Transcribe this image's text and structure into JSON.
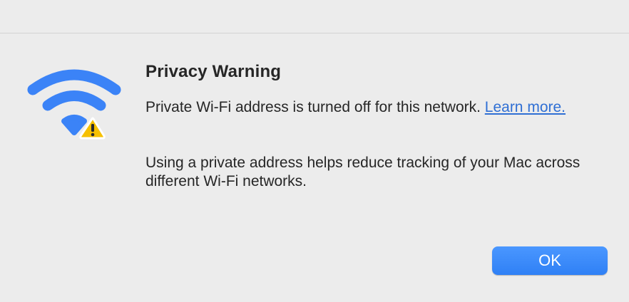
{
  "dialog": {
    "title": "Privacy Warning",
    "message_text": "Private Wi-Fi address is turned off for this network. ",
    "learn_more_link": "Learn more.",
    "secondary_text": "Using a private address helps reduce tracking of your Mac across different Wi-Fi networks.",
    "ok_button": "OK",
    "icon": "wifi-warning-icon"
  },
  "colors": {
    "accent": "#3b83f7",
    "warning": "#f6c000",
    "background": "#ececec"
  }
}
